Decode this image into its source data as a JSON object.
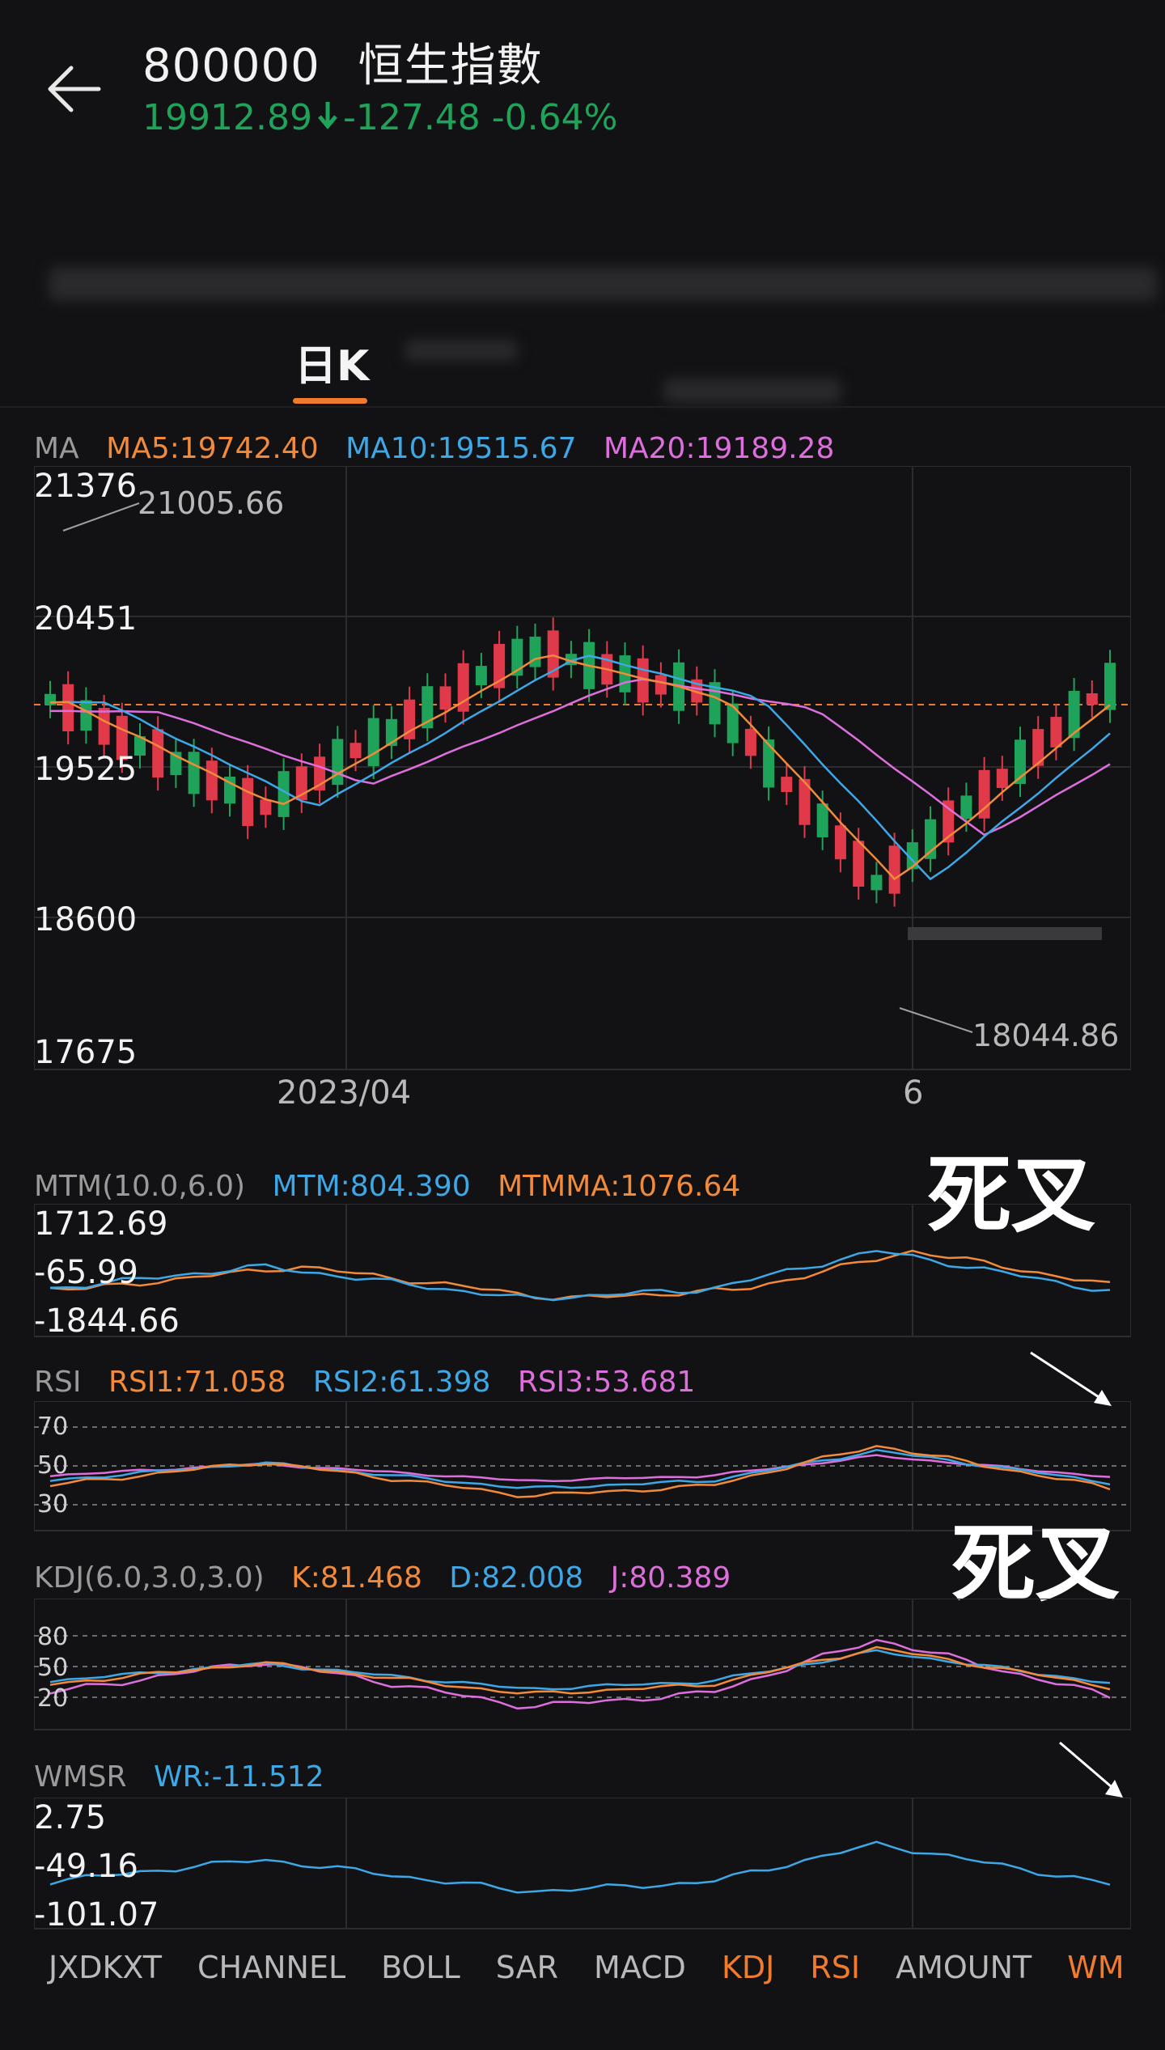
{
  "header": {
    "code": "800000",
    "name": "恒生指數",
    "price": "19912.89",
    "change": "-127.48",
    "change_pct": "-0.64%",
    "price_color": "#1fa35a"
  },
  "tabs": {
    "active": "日K"
  },
  "main_chart": {
    "indicator": "MA",
    "ma5": "MA5:19742.40",
    "ma10": "MA10:19515.67",
    "ma20": "MA20:19189.28",
    "y_labels": [
      "21376",
      "20451",
      "19525",
      "18600",
      "17675"
    ],
    "high_label": "21005.66",
    "low_label": "18044.86",
    "x_labels": [
      "2023/04",
      "6"
    ],
    "colors": {
      "ma5": "#f28a3b",
      "ma10": "#3ea7e6",
      "ma20": "#dd6fdc",
      "up": "#e0394a",
      "down": "#1fa35a"
    }
  },
  "mtm": {
    "title": "MTM(10.0,6.0)",
    "mtm": "MTM:804.390",
    "mtmma": "MTMMA:1076.64",
    "y_labels": [
      "1712.69",
      "-65.99",
      "-1844.66"
    ]
  },
  "rsi": {
    "title": "RSI",
    "rsi1": "RSI1:71.058",
    "rsi2": "RSI2:61.398",
    "rsi3": "RSI3:53.681",
    "levels": [
      "70",
      "50",
      "30"
    ]
  },
  "kdj": {
    "title": "KDJ(6.0,3.0,3.0)",
    "k": "K:81.468",
    "d": "D:82.008",
    "j": "J:80.389",
    "levels": [
      "80",
      "50",
      "20"
    ]
  },
  "wmsr": {
    "title": "WMSR",
    "wr": "WR:-11.512",
    "y_labels": [
      "2.75",
      "-49.16",
      "-101.07"
    ]
  },
  "annotations": {
    "death_cross_1": "死叉",
    "death_cross_2": "死叉"
  },
  "bottom_tabs": [
    {
      "label": "JXDKXT",
      "active": false
    },
    {
      "label": "CHANNEL",
      "active": false
    },
    {
      "label": "BOLL",
      "active": false
    },
    {
      "label": "SAR",
      "active": false
    },
    {
      "label": "MACD",
      "active": false
    },
    {
      "label": "KDJ",
      "active": true
    },
    {
      "label": "RSI",
      "active": true
    },
    {
      "label": "AMOUNT",
      "active": false
    },
    {
      "label": "WM",
      "active": true
    }
  ]
}
